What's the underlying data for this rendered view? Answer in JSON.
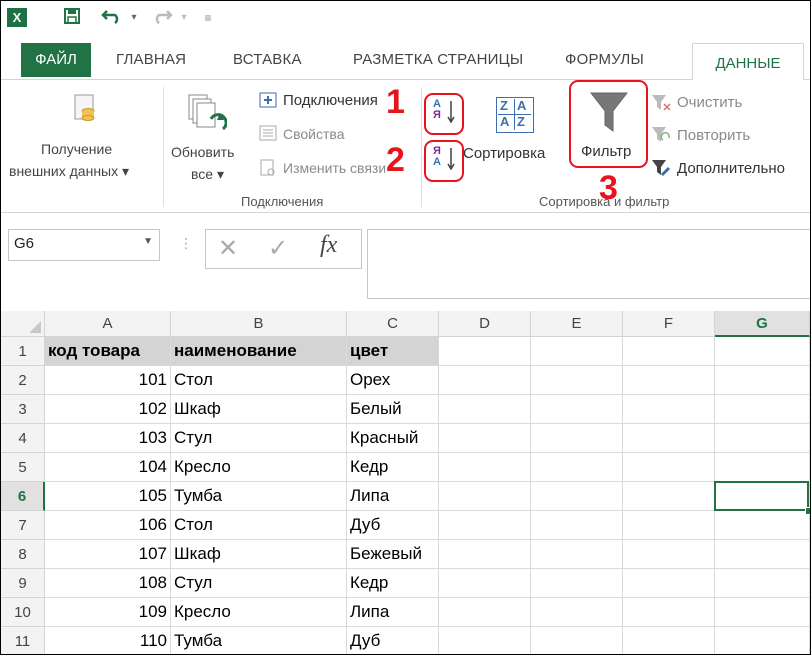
{
  "window": {
    "app_icon": "excel-icon",
    "save_icon": "save-icon",
    "undo_icon": "undo-icon",
    "redo_icon": "redo-icon",
    "customize_icon": "customize-qat-icon"
  },
  "tabs": {
    "file": "ФАЙЛ",
    "items": [
      "ГЛАВНАЯ",
      "ВСТАВКА",
      "РАЗМЕТКА СТРАНИЦЫ",
      "ФОРМУЛЫ"
    ],
    "active": "ДАННЫЕ"
  },
  "ribbon": {
    "get_external": {
      "line1": "Получение",
      "line2": "внешних данных ▾"
    },
    "refresh": {
      "line1": "Обновить",
      "line2": "все ▾"
    },
    "connections_items": [
      "Подключения",
      "Свойства",
      "Изменить связи"
    ],
    "connections_group": "Подключения",
    "sort_label": "Сортировка",
    "filter_label": "Фильтр",
    "filter_items": [
      "Очистить",
      "Повторить",
      "Дополнительно"
    ],
    "sort_filter_group": "Сортировка и фильтр",
    "annotations": [
      "1",
      "2",
      "3"
    ],
    "sort_az_glyph": {
      "top": "А",
      "bottom": "Я"
    },
    "sort_za_glyph": {
      "top": "Я",
      "bottom": "А"
    },
    "sort_dialog_glyph": {
      "tl": "Z",
      "tr": "А",
      "bl": "А",
      "br": "Z"
    },
    "annotation_color": "#e8141d"
  },
  "formula_bar": {
    "name_box": "G6",
    "cancel": "✕",
    "enter": "✓",
    "fx": "fx",
    "value": ""
  },
  "sheet": {
    "columns": [
      "A",
      "B",
      "C",
      "D",
      "E",
      "F",
      "G"
    ],
    "selected_column": "G",
    "selected_row": "6",
    "header_row": [
      "код товара",
      "наименование",
      "цвет"
    ],
    "rows": [
      {
        "n": "2",
        "code": "101",
        "name": "Стол",
        "color": "Орех"
      },
      {
        "n": "3",
        "code": "102",
        "name": "Шкаф",
        "color": "Белый"
      },
      {
        "n": "4",
        "code": "103",
        "name": "Стул",
        "color": "Красный"
      },
      {
        "n": "5",
        "code": "104",
        "name": "Кресло",
        "color": "Кедр"
      },
      {
        "n": "6",
        "code": "105",
        "name": "Тумба",
        "color": "Липа"
      },
      {
        "n": "7",
        "code": "106",
        "name": "Стол",
        "color": "Дуб"
      },
      {
        "n": "8",
        "code": "107",
        "name": "Шкаф",
        "color": "Бежевый"
      },
      {
        "n": "9",
        "code": "108",
        "name": "Стул",
        "color": "Кедр"
      },
      {
        "n": "10",
        "code": "109",
        "name": "Кресло",
        "color": "Липа"
      },
      {
        "n": "11",
        "code": "110",
        "name": "Тумба",
        "color": "Дуб"
      }
    ],
    "first_row_number": "1",
    "accent": "#217346"
  }
}
